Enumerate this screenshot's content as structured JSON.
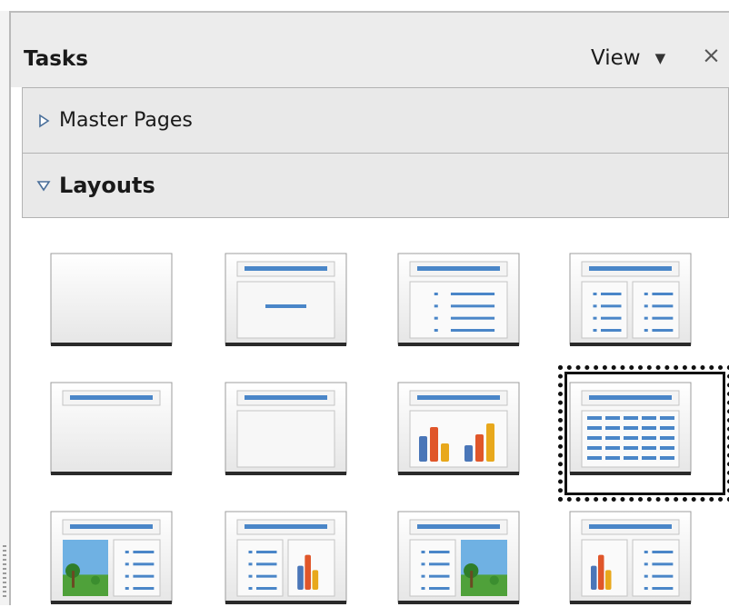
{
  "panel": {
    "title": "Tasks",
    "view_label": "View",
    "close_symbol": "×"
  },
  "sections": {
    "master_pages": {
      "label": "Master Pages",
      "state": "collapsed"
    },
    "layouts": {
      "label": "Layouts",
      "state": "expanded"
    }
  },
  "layouts": [
    {
      "name": "layout-blank",
      "icon": "blank-slide-icon"
    },
    {
      "name": "layout-title-slide",
      "icon": "title-slide-icon"
    },
    {
      "name": "layout-title-content",
      "icon": "title-content-icon"
    },
    {
      "name": "layout-title-2-content",
      "icon": "title-2-content-icon"
    },
    {
      "name": "layout-title-only",
      "icon": "title-only-icon"
    },
    {
      "name": "layout-centered-text",
      "icon": "centered-text-icon"
    },
    {
      "name": "layout-title-chart",
      "icon": "title-chart-icon"
    },
    {
      "name": "layout-title-table",
      "icon": "title-table-icon",
      "selected": true
    },
    {
      "name": "layout-title-image-content",
      "icon": "title-image-content-icon"
    },
    {
      "name": "layout-title-content-chart",
      "icon": "title-content-chart-icon"
    },
    {
      "name": "layout-title-content-image",
      "icon": "title-content-image-icon"
    },
    {
      "name": "layout-title-chart-content",
      "icon": "title-chart-content-icon"
    }
  ],
  "colors": {
    "accent_blue": "#4a86c8",
    "section_bg": "#e9e9e9",
    "selection_border": "#111111"
  }
}
